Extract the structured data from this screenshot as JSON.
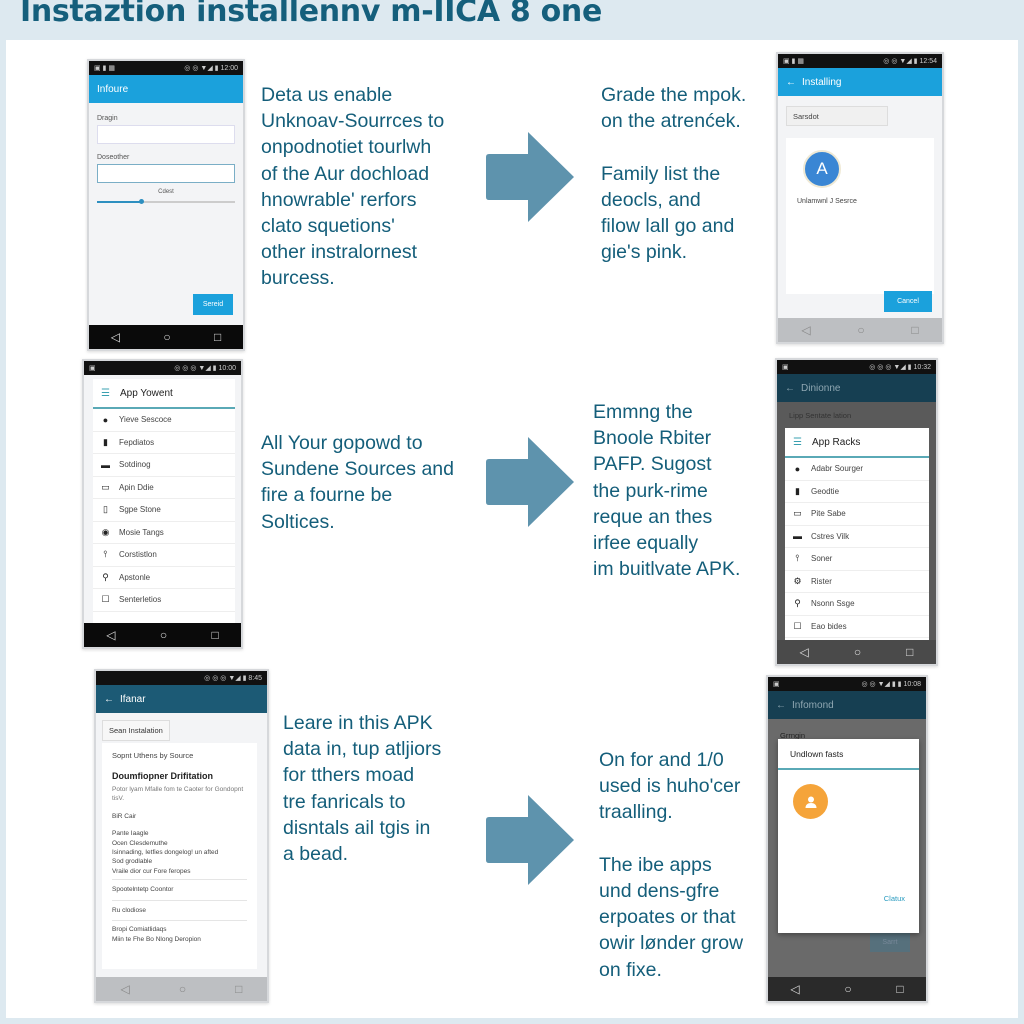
{
  "title": "Instaztion installennv m-IICA 8 one",
  "colors": {
    "accent": "#1ba1dc",
    "arrow": "#5e93ad",
    "text": "#145e7a",
    "orange": "#f5a43a"
  },
  "steps": [
    {
      "lines": [
        "Deta us enable",
        "Unknoav-Sourrces to",
        "onpodnotiet tourlwh",
        "of the Aur dochload",
        "hnowrable' rerfors",
        "clato squetions'",
        "other instralornest",
        "burcess."
      ]
    },
    {
      "lines": [
        "Grade the mpok.",
        "on the atrenćek.",
        "",
        "Family list the",
        "deocls, and",
        "filow lall go and",
        "gie's pink."
      ]
    },
    {
      "lines": [
        "All Your gopowd to",
        "Sundene Sources and",
        "fire a fourne be",
        "Soltices."
      ]
    },
    {
      "lines": [
        "Emmng the",
        "Bnoole Rbiter",
        "PAFP. Sugost",
        "the purk-rime",
        "reque an thes",
        "irfee equally",
        "im buitlvate APK."
      ]
    },
    {
      "lines": [
        "Leare in this APK",
        "data in, tup atljiors",
        "for tthers moad",
        "tre fanricals to",
        "disntals ail tgis in",
        "a bead."
      ]
    },
    {
      "lines": [
        "On for and 1/0",
        "used is huho'cer",
        "traalling.",
        "",
        "The ibe apps",
        "und dens-gfre",
        "erpoates or that",
        "owir lønder grow",
        "on fixe."
      ]
    }
  ],
  "phone1": {
    "appbar_title": "Infoure",
    "field1_label": "Dragin",
    "field2_label": "Doseother",
    "slider_label": "Cdest",
    "slider_value": 0.32,
    "button": "Sereid",
    "status_time": "12:00"
  },
  "phone2": {
    "appbar_title": "Installing",
    "search_value": "Sarsdot",
    "avatar_letter": "A",
    "app_name": "Unlamwnl J Sesrce",
    "button": "Cancel",
    "status_time": "12:54"
  },
  "phone3": {
    "header": "App Yowent",
    "items": [
      {
        "icon": "disc-icon",
        "glyph": "●",
        "label": "Yieve Sescoce"
      },
      {
        "icon": "sd-card-icon",
        "glyph": "▮",
        "label": "Fepdiatos"
      },
      {
        "icon": "storage-icon",
        "glyph": "▬",
        "label": "Sotdinog"
      },
      {
        "icon": "card-icon",
        "glyph": "▭",
        "label": "Apin Ddie"
      },
      {
        "icon": "phone-icon",
        "glyph": "▯",
        "label": "Sgpe Stone"
      },
      {
        "icon": "music-icon",
        "glyph": "◉",
        "label": "Mosie Tangs"
      },
      {
        "icon": "usb-icon",
        "glyph": "⫯",
        "label": "Corstistlon"
      },
      {
        "icon": "pin-icon",
        "glyph": "⚲",
        "label": "Apstonle"
      },
      {
        "icon": "checkbox-icon",
        "glyph": "☐",
        "label": "Senterletios"
      }
    ],
    "status_time": "10:00"
  },
  "phone4": {
    "appbar_title": "Dinionne",
    "section_title": "Lipp Sentate lation",
    "header": "App Racks",
    "items": [
      {
        "icon": "disc-icon",
        "glyph": "●",
        "label": "Adabr Sourger"
      },
      {
        "icon": "sd-card-icon",
        "glyph": "▮",
        "label": "Geodtie"
      },
      {
        "icon": "card-icon",
        "glyph": "▭",
        "label": "Pite Sabe"
      },
      {
        "icon": "storage-icon",
        "glyph": "▬",
        "label": "Cstres Vilk"
      },
      {
        "icon": "usb-icon",
        "glyph": "⫯",
        "label": "Soner"
      },
      {
        "icon": "settings-icon",
        "glyph": "⚙",
        "label": "Rister"
      },
      {
        "icon": "pin-icon",
        "glyph": "⚲",
        "label": "Nsonn Ssge"
      },
      {
        "icon": "checkbox-icon",
        "glyph": "☐",
        "label": "Eao bides"
      }
    ],
    "status_time": "10:32"
  },
  "phone5": {
    "appbar_title": "Ifanar",
    "chip": "Sean Instalation",
    "card_title": "Sopnt Uthens by Source",
    "card_heading": "Doumfiopner Drifitation",
    "card_desc": "Potor lyam Mfalle fom te Caoter for Gondopnt tisV.",
    "label1": "BiR Cair",
    "block_lines": [
      "Pante Iaagle",
      "Ocen Clesdemuthe",
      "Isinnading, Ietfies dongelog! un afted",
      "Sod grodlable",
      "Vraile dior cur Fore feropes"
    ],
    "row1": "Spootelntetp Coontor",
    "row2": "Ru clodiose",
    "row3_lines": [
      "Bropi Comiatlidaqs",
      "Miin te Fhe Bo Nlong Deropion"
    ],
    "status_time": "8:45"
  },
  "phone6": {
    "appbar_title": "Infomond",
    "bg_label": "Grrngin",
    "dialog_title": "Undlown fasts",
    "dialog_button": "Clatux",
    "bg_button": "Sarrt",
    "status_time": "10:08"
  }
}
